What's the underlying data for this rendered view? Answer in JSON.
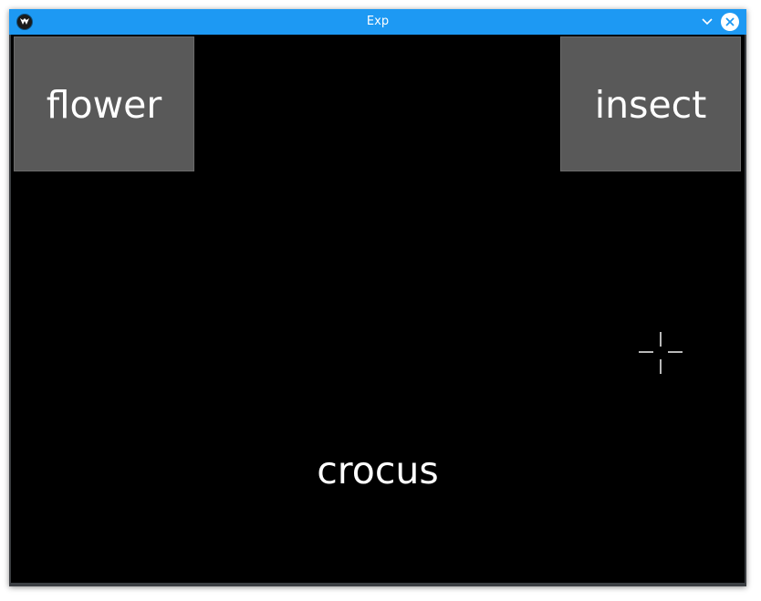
{
  "window": {
    "title": "Exp",
    "titlebar_color": "#1d99f3",
    "background_color": "#000000"
  },
  "titlebar": {
    "app_icon": "kivy-logo-icon",
    "minimize_icon": "chevron-down-icon",
    "close_icon": "close-icon"
  },
  "task": {
    "left_option": "flower",
    "right_option": "insect",
    "stimulus_word": "crocus",
    "option_box_color": "#595959"
  },
  "cursor": {
    "icon": "crosshair-cursor-icon"
  }
}
